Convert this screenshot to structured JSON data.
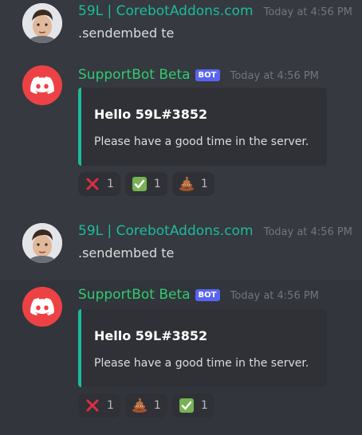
{
  "messages": [
    {
      "author": "59L | CorebotAddons.com",
      "timestamp": "Today at 4:56 PM",
      "content": ".sendembed te"
    },
    {
      "author": "SupportBot Beta",
      "bot_tag": "BOT",
      "timestamp": "Today at 4:56 PM",
      "embed": {
        "title": "Hello 59L#3852",
        "description": "Please have a good time in the server.",
        "accent": "#1abc9c"
      },
      "reactions": [
        {
          "emoji": "cross-mark-icon",
          "count": "1"
        },
        {
          "emoji": "check-mark-icon",
          "count": "1"
        },
        {
          "emoji": "poop-icon",
          "count": "1"
        }
      ]
    },
    {
      "author": "59L | CorebotAddons.com",
      "timestamp": "Today at 4:56 PM",
      "content": ".sendembed te"
    },
    {
      "author": "SupportBot Beta",
      "bot_tag": "BOT",
      "timestamp": "Today at 4:56 PM",
      "embed": {
        "title": "Hello 59L#3852",
        "description": "Please have a good time in the server.",
        "accent": "#1abc9c"
      },
      "reactions": [
        {
          "emoji": "cross-mark-icon",
          "count": "1"
        },
        {
          "emoji": "poop-icon",
          "count": "1"
        },
        {
          "emoji": "check-mark-icon",
          "count": "1"
        }
      ]
    }
  ],
  "colors": {
    "background": "#36393f",
    "user_name": "#1abc9c",
    "bot_name": "#2ecc71",
    "bot_tag": "#5865f2",
    "discord_red": "#ed4245"
  }
}
